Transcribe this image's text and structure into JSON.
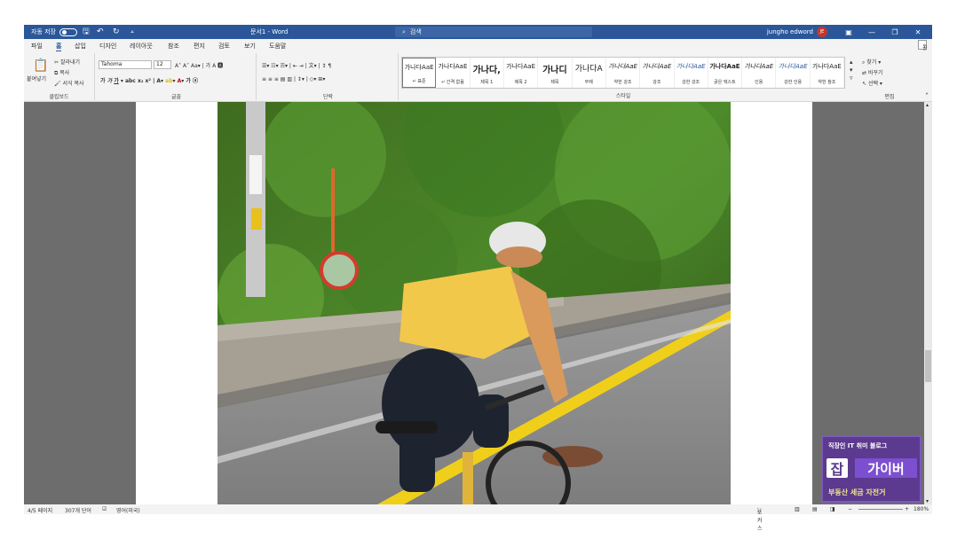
{
  "titlebar": {
    "autosave_label": "자동 저장",
    "autosave_state": "끔",
    "doc_title": "문서1 - Word",
    "search_placeholder": "검색",
    "user_name": "jungho edword",
    "user_initials": "JE"
  },
  "tabs": [
    "파일",
    "홈",
    "삽입",
    "디자인",
    "레이아웃",
    "참조",
    "편지",
    "검토",
    "보기",
    "도움말"
  ],
  "active_tab": "홈",
  "share_label": "공유",
  "ribbon": {
    "clipboard": {
      "paste": "붙여넣기",
      "cut": "잘라내기",
      "copy": "복사",
      "format_painter": "서식 복사",
      "label": "클립보드"
    },
    "font": {
      "name": "Tahoma",
      "size": "12",
      "label": "글꼴"
    },
    "paragraph": {
      "label": "단락"
    },
    "styles": {
      "label": "스타일",
      "items": [
        {
          "sample": "가나다AaE",
          "name": "↵ 표준"
        },
        {
          "sample": "가나다AaE",
          "name": "↵ 간격 없음"
        },
        {
          "sample": "가나다,",
          "name": "제목 1"
        },
        {
          "sample": "가나다AaE",
          "name": "제목 2"
        },
        {
          "sample": "가나디",
          "name": "제목"
        },
        {
          "sample": "가나다A",
          "name": "부제"
        },
        {
          "sample": "가나다AaE",
          "name": "약한 강조"
        },
        {
          "sample": "가나다AaE",
          "name": "강조"
        },
        {
          "sample": "가나다AaE",
          "name": "강한 강조"
        },
        {
          "sample": "가나다AaE",
          "name": "굵은 텍스트"
        },
        {
          "sample": "가나다AaE",
          "name": "인용"
        },
        {
          "sample": "가나다AaE",
          "name": "강한 인용"
        },
        {
          "sample": "가나다AaE",
          "name": "약한 참조"
        }
      ]
    },
    "editing": {
      "find": "찾기",
      "replace": "바꾸기",
      "select": "선택",
      "label": "편집"
    }
  },
  "statusbar": {
    "page": "4/5 페이지",
    "words": "307개 단어",
    "language": "영어(미국)",
    "focus": "포커스",
    "zoom": "180%"
  },
  "watermark": {
    "line1": "직장인 IT 취미 블로그",
    "logo_char": "잡",
    "brand": "가이버",
    "line3": "부동산 세금 자전거"
  },
  "colors": {
    "accent": "#2b579a",
    "workspace": "#6d6d6d",
    "watermark": "#5b3a8f"
  }
}
